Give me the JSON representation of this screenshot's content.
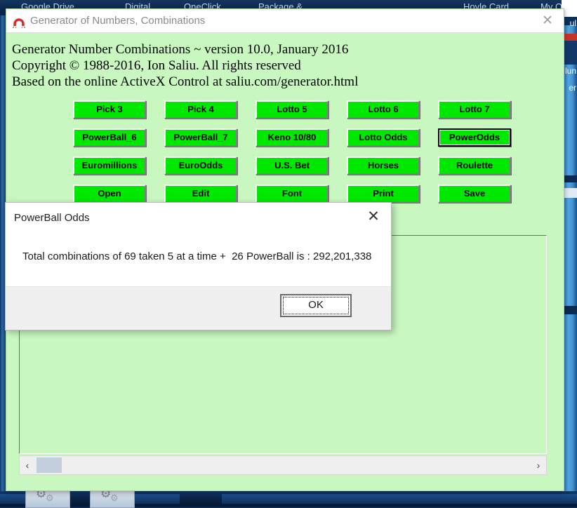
{
  "desktop": {
    "background_window_menu": [
      "Google Drive",
      "Digital",
      "OneClick",
      "Package &",
      "Hoyle Card",
      "My O"
    ],
    "right_strip_text": [
      "ul",
      "lun",
      "er"
    ],
    "taskbar_icons": [
      "gear-icon",
      "gear-icon"
    ]
  },
  "main_window": {
    "title": "Generator of Numbers, Combinations",
    "icon": "magnet-icon",
    "close_label": "✕",
    "header_lines": [
      "Generator Number Combinations ~ version 10.0, January 2016",
      "Copyright © 1988-2016, Ion Saliu. All rights reserved",
      "Based on the online ActiveX Control at saliu.com/generator.html"
    ],
    "buttons": [
      {
        "label": "Pick 3",
        "focused": false
      },
      {
        "label": "Pick 4",
        "focused": false
      },
      {
        "label": "Lotto 5",
        "focused": false
      },
      {
        "label": "Lotto 6",
        "focused": false
      },
      {
        "label": "Lotto 7",
        "focused": false
      },
      {
        "label": "PowerBall_6",
        "focused": false
      },
      {
        "label": "PowerBall_7",
        "focused": false
      },
      {
        "label": "Keno 10/80",
        "focused": false
      },
      {
        "label": "Lotto Odds",
        "focused": false
      },
      {
        "label": "PowerOdds",
        "focused": true
      },
      {
        "label": "Euromillions",
        "focused": false
      },
      {
        "label": "EuroOdds",
        "focused": false
      },
      {
        "label": "U.S. Bet",
        "focused": false
      },
      {
        "label": "Horses",
        "focused": false
      },
      {
        "label": "Roulette",
        "focused": false
      },
      {
        "label": "Open",
        "focused": false
      },
      {
        "label": "Edit",
        "focused": false
      },
      {
        "label": "Font",
        "focused": false
      },
      {
        "label": "Print",
        "focused": false
      },
      {
        "label": "Save",
        "focused": false
      }
    ],
    "content_panel_text": "",
    "scrollbar": {
      "left_arrow": "‹",
      "right_arrow": "›"
    }
  },
  "dialog": {
    "title": "PowerBall Odds",
    "close_label": "✕",
    "message": "Total combinations of 69 taken 5 at a time +  26 PowerBall is : 292,201,338",
    "ok_label": "OK"
  },
  "colors": {
    "button_green": "#00e800",
    "window_green": "#c8f7c0",
    "titlebar_white": "#ffffff",
    "dialog_footer_gray": "#f0f0f0",
    "desktop_blue": "#07254b"
  }
}
